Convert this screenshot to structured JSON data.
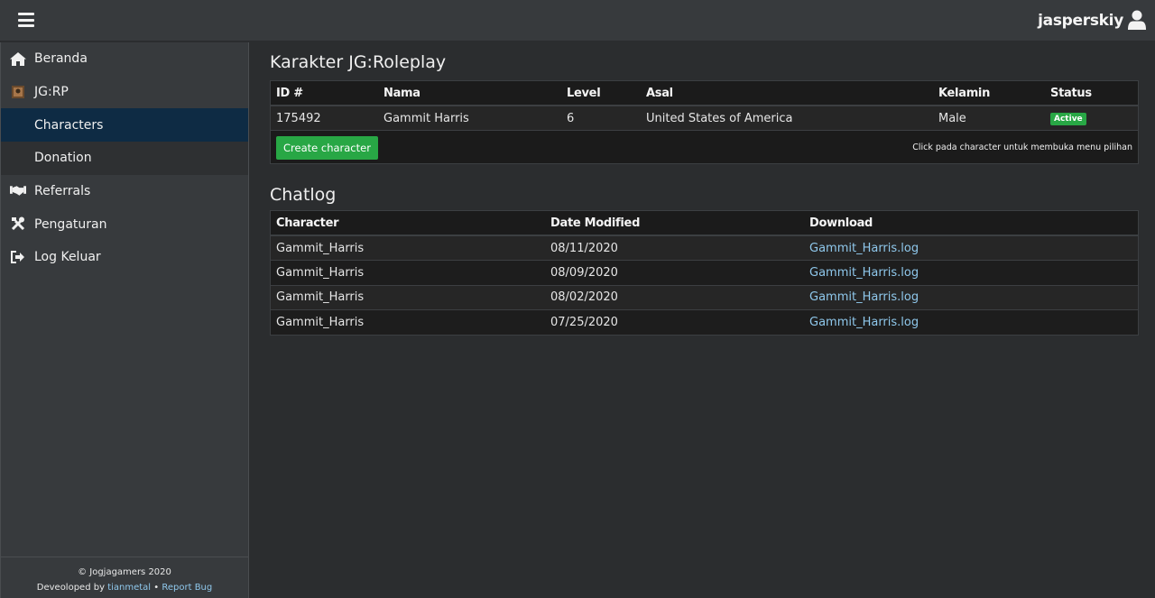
{
  "header": {
    "username": "jasperskiy"
  },
  "sidebar": {
    "items": [
      {
        "label": "Beranda",
        "icon": "home-icon"
      },
      {
        "label": "JG:RP",
        "icon": "jgrp-logo-icon"
      },
      {
        "label": "Characters",
        "sub": true,
        "active": true
      },
      {
        "label": "Donation",
        "sub": true
      },
      {
        "label": "Referrals",
        "icon": "handshake-icon"
      },
      {
        "label": "Pengaturan",
        "icon": "tools-icon"
      },
      {
        "label": "Log Keluar",
        "icon": "sign-out-icon"
      }
    ],
    "footer": {
      "copyright": "© Jogjagamers 2020",
      "developed_by": "Deveoloped by",
      "developer": "tianmetal",
      "separator": "•",
      "report_bug": "Report Bug"
    }
  },
  "characters": {
    "title": "Karakter JG:Roleplay",
    "columns": [
      "ID #",
      "Nama",
      "Level",
      "Asal",
      "Kelamin",
      "Status"
    ],
    "rows": [
      {
        "id": "175492",
        "name": "Gammit Harris",
        "level": "6",
        "origin": "United States of America",
        "gender": "Male",
        "status": "Active"
      }
    ],
    "create_button": "Create character",
    "hint": "Click pada character untuk membuka menu pilihan"
  },
  "chatlog": {
    "title": "Chatlog",
    "columns": [
      "Character",
      "Date Modified",
      "Download"
    ],
    "rows": [
      {
        "character": "Gammit_Harris",
        "date": "08/11/2020",
        "file": "Gammit_Harris.log"
      },
      {
        "character": "Gammit_Harris",
        "date": "08/09/2020",
        "file": "Gammit_Harris.log"
      },
      {
        "character": "Gammit_Harris",
        "date": "08/02/2020",
        "file": "Gammit_Harris.log"
      },
      {
        "character": "Gammit_Harris",
        "date": "07/25/2020",
        "file": "Gammit_Harris.log"
      }
    ]
  },
  "colors": {
    "accent_green": "#28a745",
    "link": "#8fc8ec",
    "active_nav": "#0e2b44"
  }
}
